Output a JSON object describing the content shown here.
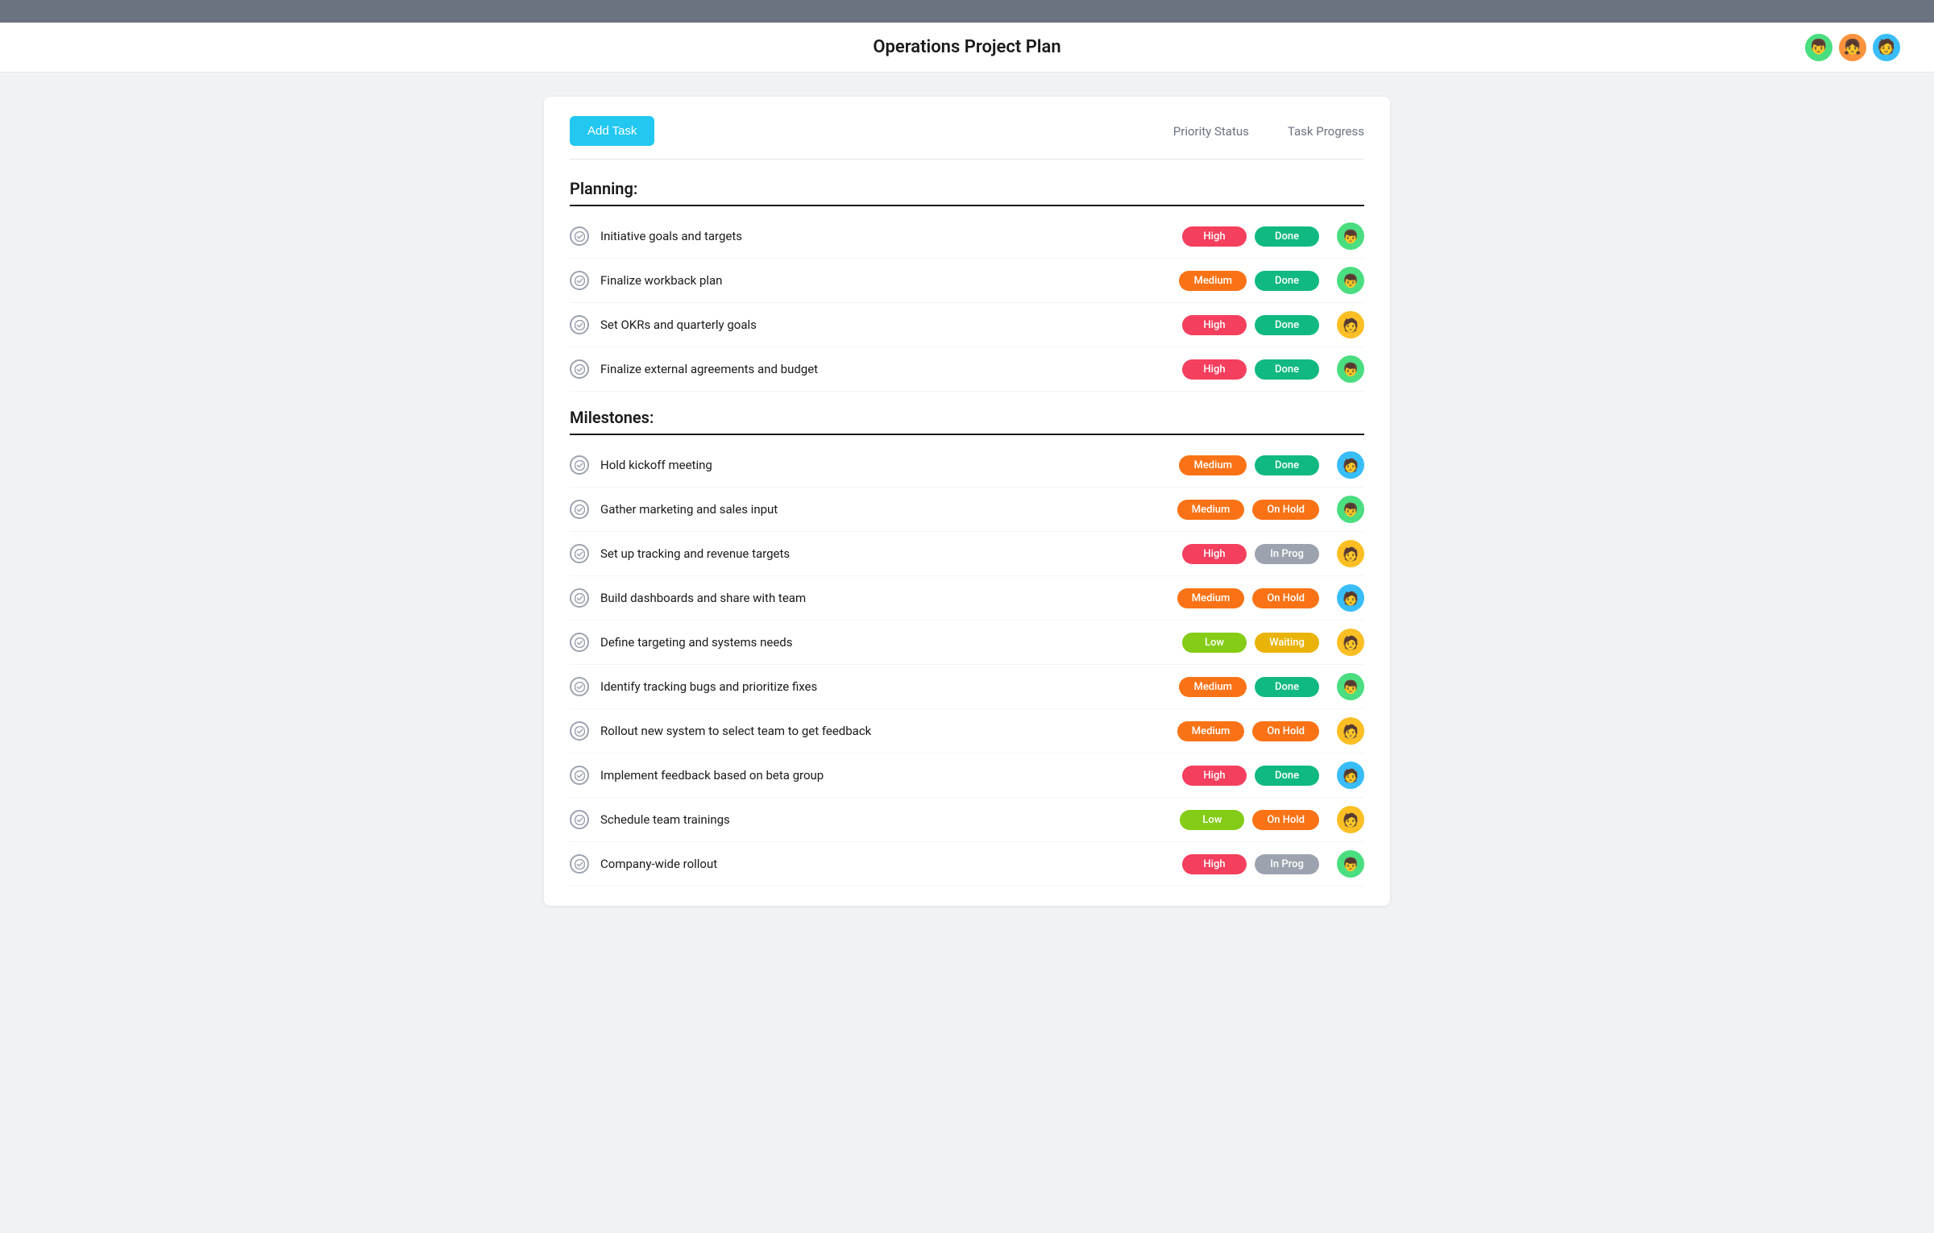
{
  "app": {
    "top_bar": "",
    "title": "Operations Project Plan",
    "add_task_label": "Add Task",
    "col_priority": "Priority Status",
    "col_progress": "Task Progress"
  },
  "avatars": [
    {
      "id": "av1",
      "emoji": "👦",
      "color": "#4ade80"
    },
    {
      "id": "av2",
      "emoji": "👧",
      "color": "#fb923c"
    },
    {
      "id": "av3",
      "emoji": "🧑",
      "color": "#60a5fa"
    }
  ],
  "sections": [
    {
      "title": "Planning:",
      "tasks": [
        {
          "name": "Initiative goals and targets",
          "priority": "High",
          "priority_class": "badge-high",
          "status": "Done",
          "status_class": "badge-done",
          "avatar_emoji": "👦",
          "avatar_class": "av-green"
        },
        {
          "name": "Finalize workback plan",
          "priority": "Medium",
          "priority_class": "badge-medium",
          "status": "Done",
          "status_class": "badge-done",
          "avatar_emoji": "👦",
          "avatar_class": "av-green"
        },
        {
          "name": "Set OKRs and quarterly goals",
          "priority": "High",
          "priority_class": "badge-high",
          "status": "Done",
          "status_class": "badge-done",
          "avatar_emoji": "🧑",
          "avatar_class": "av-yellow"
        },
        {
          "name": "Finalize external agreements and budget",
          "priority": "High",
          "priority_class": "badge-high",
          "status": "Done",
          "status_class": "badge-done",
          "avatar_emoji": "👦",
          "avatar_class": "av-green"
        }
      ]
    },
    {
      "title": "Milestones:",
      "tasks": [
        {
          "name": "Hold kickoff meeting",
          "priority": "Medium",
          "priority_class": "badge-medium",
          "status": "Done",
          "status_class": "badge-done",
          "avatar_emoji": "🧑",
          "avatar_class": "av-blue"
        },
        {
          "name": "Gather marketing and sales input",
          "priority": "Medium",
          "priority_class": "badge-medium",
          "status": "On Hold",
          "status_class": "badge-on-hold",
          "avatar_emoji": "👦",
          "avatar_class": "av-green"
        },
        {
          "name": "Set up tracking and revenue targets",
          "priority": "High",
          "priority_class": "badge-high",
          "status": "In Prog",
          "status_class": "badge-in-prog",
          "avatar_emoji": "🧑",
          "avatar_class": "av-yellow"
        },
        {
          "name": "Build dashboards and share with team",
          "priority": "Medium",
          "priority_class": "badge-medium",
          "status": "On Hold",
          "status_class": "badge-on-hold",
          "avatar_emoji": "🧑",
          "avatar_class": "av-blue"
        },
        {
          "name": "Define targeting and systems needs",
          "priority": "Low",
          "priority_class": "badge-low",
          "status": "Waiting",
          "status_class": "badge-waiting",
          "avatar_emoji": "🧑",
          "avatar_class": "av-yellow"
        },
        {
          "name": "Identify tracking bugs and prioritize fixes",
          "priority": "Medium",
          "priority_class": "badge-medium",
          "status": "Done",
          "status_class": "badge-done",
          "avatar_emoji": "👦",
          "avatar_class": "av-green"
        },
        {
          "name": "Rollout new system to select team to get feedback",
          "priority": "Medium",
          "priority_class": "badge-medium",
          "status": "On Hold",
          "status_class": "badge-on-hold",
          "avatar_emoji": "🧑",
          "avatar_class": "av-yellow"
        },
        {
          "name": "Implement feedback based on beta group",
          "priority": "High",
          "priority_class": "badge-high",
          "status": "Done",
          "status_class": "badge-done",
          "avatar_emoji": "🧑",
          "avatar_class": "av-blue"
        },
        {
          "name": "Schedule team trainings",
          "priority": "Low",
          "priority_class": "badge-low",
          "status": "On Hold",
          "status_class": "badge-on-hold",
          "avatar_emoji": "🧑",
          "avatar_class": "av-yellow"
        },
        {
          "name": "Company-wide rollout",
          "priority": "High",
          "priority_class": "badge-high",
          "status": "In Prog",
          "status_class": "badge-in-prog",
          "avatar_emoji": "👦",
          "avatar_class": "av-green"
        }
      ]
    }
  ]
}
